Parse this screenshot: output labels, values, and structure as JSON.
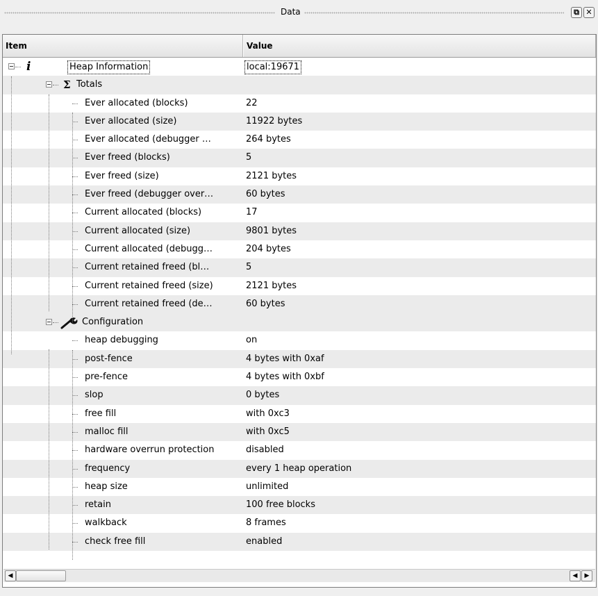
{
  "window": {
    "title": "Data",
    "float_symbol": "⧉",
    "close_symbol": "✕"
  },
  "columns": {
    "item": "Item",
    "value": "Value"
  },
  "root": {
    "label": "Heap Information",
    "value": "local:19671",
    "icon": "info-icon"
  },
  "totals": {
    "label": "Totals",
    "icon": "sigma-icon",
    "items": [
      {
        "label": "Ever allocated (blocks)",
        "value": "22"
      },
      {
        "label": "Ever allocated (size)",
        "value": "11922 bytes"
      },
      {
        "label": "Ever allocated (debugger …",
        "value": "264 bytes"
      },
      {
        "label": "Ever freed (blocks)",
        "value": "5"
      },
      {
        "label": "Ever freed (size)",
        "value": "2121 bytes"
      },
      {
        "label": "Ever freed (debugger over…",
        "value": "60 bytes"
      },
      {
        "label": "Current allocated (blocks)",
        "value": "17"
      },
      {
        "label": "Current allocated (size)",
        "value": "9801 bytes"
      },
      {
        "label": "Current allocated (debugg…",
        "value": "204 bytes"
      },
      {
        "label": "Current retained freed (bl…",
        "value": "5"
      },
      {
        "label": "Current retained freed (size)",
        "value": "2121 bytes"
      },
      {
        "label": "Current retained freed (de…",
        "value": "60 bytes"
      }
    ]
  },
  "configuration": {
    "label": "Configuration",
    "icon": "wrench-icon",
    "items": [
      {
        "label": "heap debugging",
        "value": "on"
      },
      {
        "label": "post-fence",
        "value": "4 bytes with 0xaf"
      },
      {
        "label": "pre-fence",
        "value": "4 bytes with 0xbf"
      },
      {
        "label": "slop",
        "value": "0 bytes"
      },
      {
        "label": "free fill",
        "value": "with 0xc3"
      },
      {
        "label": "malloc fill",
        "value": "with 0xc5"
      },
      {
        "label": "hardware overrun protection",
        "value": "disabled"
      },
      {
        "label": "frequency",
        "value": "every 1 heap operation"
      },
      {
        "label": "heap size",
        "value": "unlimited"
      },
      {
        "label": "retain",
        "value": "100 free blocks"
      },
      {
        "label": "walkback",
        "value": "8 frames"
      },
      {
        "label": "check free fill",
        "value": "enabled"
      }
    ]
  },
  "scrollbar": {
    "left_arrow": "◀",
    "right_arrow": "▶"
  }
}
